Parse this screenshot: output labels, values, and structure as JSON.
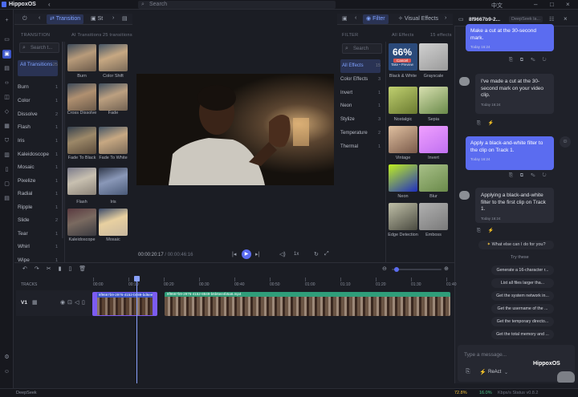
{
  "app": {
    "title": "HippoxOS",
    "search_placeholder": "Search",
    "lang": "中文"
  },
  "left_sidebar": {
    "icons": [
      "plus-icon",
      "chat-icon",
      "media-icon",
      "chart-icon",
      "code-icon",
      "map-icon",
      "box-icon",
      "grid-icon",
      "shield-icon",
      "storage-icon",
      "clipboard-icon",
      "document-icon",
      "settings-icon",
      "user-icon"
    ]
  },
  "transition_panel": {
    "tab_transition": "Transition",
    "tab_sticker": "St",
    "section_label": "TRANSITION",
    "search_placeholder": "Search t...",
    "all_label": "AI Transitions",
    "all_count": "25 transitions",
    "categories": [
      {
        "name": "All Transitions",
        "count": "25"
      },
      {
        "name": "Burn",
        "count": "1"
      },
      {
        "name": "Color",
        "count": "1"
      },
      {
        "name": "Dissolve",
        "count": "2"
      },
      {
        "name": "Flash",
        "count": "1"
      },
      {
        "name": "Iris",
        "count": "1"
      },
      {
        "name": "Kaleidoscope",
        "count": "1"
      },
      {
        "name": "Mosaic",
        "count": "1"
      },
      {
        "name": "Pixelize",
        "count": "1"
      },
      {
        "name": "Radial",
        "count": "1"
      },
      {
        "name": "Ripple",
        "count": "1"
      },
      {
        "name": "Slide",
        "count": "2"
      },
      {
        "name": "Tear",
        "count": "1"
      },
      {
        "name": "Whirl",
        "count": "1"
      },
      {
        "name": "Wipe",
        "count": "1"
      }
    ],
    "thumbs": [
      {
        "label": "Burn"
      },
      {
        "label": "Color Shift"
      },
      {
        "label": "Cross Dissolve"
      },
      {
        "label": "Fade"
      },
      {
        "label": "Fade To Black"
      },
      {
        "label": "Fade To White"
      },
      {
        "label": "Flash"
      },
      {
        "label": "Iris"
      },
      {
        "label": "Kaleidoscope"
      },
      {
        "label": "Mosaic"
      }
    ]
  },
  "preview": {
    "current_time": "00:00:20:17",
    "total_time": "00:00:46:16",
    "speed": "1x"
  },
  "filter_panel": {
    "tab_filter": "Filter",
    "tab_visual": "Visual Effects",
    "section_label": "FILTER",
    "search_placeholder": "Search",
    "all_label": "All Effects",
    "all_count": "15 effects",
    "categories": [
      {
        "name": "All Effects",
        "count": "15"
      },
      {
        "name": "Color Effects",
        "count": "3"
      },
      {
        "name": "Invert",
        "count": "1"
      },
      {
        "name": "Neon",
        "count": "1"
      },
      {
        "name": "Stylize",
        "count": "3"
      },
      {
        "name": "Temperature",
        "count": "2"
      },
      {
        "name": "Thermal",
        "count": "1"
      }
    ],
    "thumbs": [
      {
        "label": "Black & White"
      },
      {
        "label": "Grayscale"
      },
      {
        "label": "Nostalgic"
      },
      {
        "label": "Sepia"
      },
      {
        "label": "Vintage"
      },
      {
        "label": "Invert"
      },
      {
        "label": "Neon"
      },
      {
        "label": "Blur"
      },
      {
        "label": "Edge Detection"
      },
      {
        "label": "Emboss"
      }
    ],
    "overlay_title": "66%",
    "overlay_sub": "Cancel",
    "overlay_sub2": "Take • Preview"
  },
  "timeline": {
    "tracks_label": "TRACKS",
    "track_name": "V1",
    "ruler": [
      "00:00",
      "00:10",
      "00:20",
      "00:30",
      "00:40",
      "00:50",
      "01:00",
      "01:10",
      "01:20",
      "01:30",
      "01:40"
    ],
    "clip1": "8f9667b9-2976-4152-b089-bd6ee...",
    "clip2": "8f9667b9-2976-4152-8849-b6b6ee4b5a6.mp4"
  },
  "chat": {
    "header_title": "8f9667b9-2...",
    "header_sub": "DeepSeek la...",
    "messages": [
      {
        "role": "user",
        "text": "Make a cut at the 30-second mark.",
        "time": "Today 16:24"
      },
      {
        "role": "ai",
        "text": "I've made a cut at the 30-second mark on your video clip.",
        "time": "Today 16:24"
      },
      {
        "role": "user",
        "text": "Apply a black-and-white filter to the clip on Track 1.",
        "time": "Today 16:24"
      },
      {
        "role": "ai",
        "text": "Applying a black-and-white filter to the first clip on Track 1.",
        "time": "Today 16:24"
      }
    ],
    "prompt_question": "What else can I do for you?",
    "try_these": "Try these",
    "suggestions": [
      "Generate a 16-character r...",
      "List all files larger tha...",
      "Get the system network in...",
      "Get the username of the ...",
      "Get the temporary directo...",
      "Get the total memory and ..."
    ],
    "input_placeholder": "Type a message...",
    "mode": "ReAct",
    "brand": "HippoxOS"
  },
  "status": {
    "left": "DeepSeek",
    "cpu": "72.8%",
    "mem": "16.0%",
    "net": "Kbps/s Status v0.8.2"
  }
}
